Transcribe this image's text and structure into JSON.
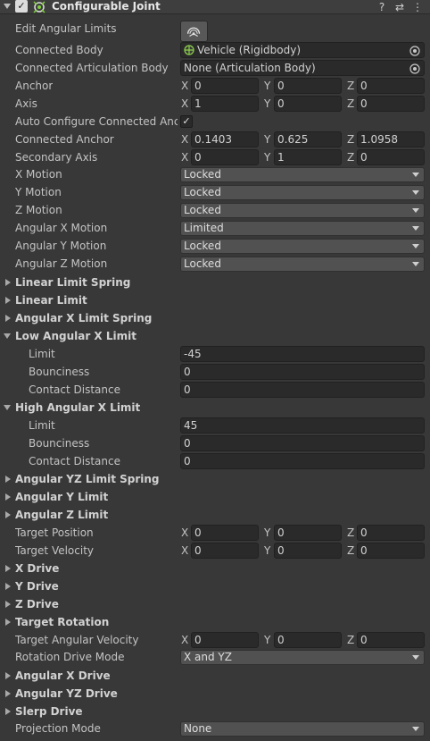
{
  "header": {
    "title": "Configurable Joint",
    "enabled_mark": "✓",
    "help_glyph": "?",
    "preset_glyph": "⇄",
    "menu_glyph": "⋮",
    "icon": "configurable-joint-icon"
  },
  "edit_angular_limits": {
    "label": "Edit Angular Limits",
    "icon": "angular-limits-icon"
  },
  "connected_body": {
    "label": "Connected Body",
    "value": "Vehicle (Rigidbody)"
  },
  "connected_articulation_body": {
    "label": "Connected Articulation Body",
    "value": "None (Articulation Body)"
  },
  "anchor": {
    "label": "Anchor",
    "x": "0",
    "y": "0",
    "z": "0"
  },
  "axis": {
    "label": "Axis",
    "x": "1",
    "y": "0",
    "z": "0"
  },
  "auto_configure": {
    "label": "Auto Configure Connected Anchor",
    "checked_mark": "✓"
  },
  "connected_anchor": {
    "label": "Connected Anchor",
    "x": "0.1403",
    "y": "0.625",
    "z": "1.0958"
  },
  "secondary_axis": {
    "label": "Secondary Axis",
    "x": "0",
    "y": "1",
    "z": "0"
  },
  "x_motion": {
    "label": "X Motion",
    "value": "Locked"
  },
  "y_motion": {
    "label": "Y Motion",
    "value": "Locked"
  },
  "z_motion": {
    "label": "Z Motion",
    "value": "Locked"
  },
  "angular_x_motion": {
    "label": "Angular X Motion",
    "value": "Limited"
  },
  "angular_y_motion": {
    "label": "Angular Y Motion",
    "value": "Locked"
  },
  "angular_z_motion": {
    "label": "Angular Z Motion",
    "value": "Locked"
  },
  "linear_limit_spring": {
    "label": "Linear Limit Spring"
  },
  "linear_limit": {
    "label": "Linear Limit"
  },
  "angular_x_limit_spring": {
    "label": "Angular X Limit Spring"
  },
  "low_angular_x_limit": {
    "label": "Low Angular X Limit",
    "limit_label": "Limit",
    "limit": "-45",
    "bounciness_label": "Bounciness",
    "bounciness": "0",
    "contact_distance_label": "Contact Distance",
    "contact_distance": "0"
  },
  "high_angular_x_limit": {
    "label": "High Angular X Limit",
    "limit_label": "Limit",
    "limit": "45",
    "bounciness_label": "Bounciness",
    "bounciness": "0",
    "contact_distance_label": "Contact Distance",
    "contact_distance": "0"
  },
  "angular_yz_limit_spring": {
    "label": "Angular YZ Limit Spring"
  },
  "angular_y_limit": {
    "label": "Angular Y Limit"
  },
  "angular_z_limit": {
    "label": "Angular Z Limit"
  },
  "target_position": {
    "label": "Target Position",
    "x": "0",
    "y": "0",
    "z": "0"
  },
  "target_velocity": {
    "label": "Target Velocity",
    "x": "0",
    "y": "0",
    "z": "0"
  },
  "x_drive": {
    "label": "X Drive"
  },
  "y_drive": {
    "label": "Y Drive"
  },
  "z_drive": {
    "label": "Z Drive"
  },
  "target_rotation": {
    "label": "Target Rotation"
  },
  "target_angular_velocity": {
    "label": "Target Angular Velocity",
    "x": "0",
    "y": "0",
    "z": "0"
  },
  "rotation_drive_mode": {
    "label": "Rotation Drive Mode",
    "value": "X and YZ"
  },
  "angular_x_drive": {
    "label": "Angular X Drive"
  },
  "angular_yz_drive": {
    "label": "Angular YZ Drive"
  },
  "slerp_drive": {
    "label": "Slerp Drive"
  },
  "projection_mode": {
    "label": "Projection Mode",
    "value": "None"
  },
  "axis_labels": {
    "x": "X",
    "y": "Y",
    "z": "Z"
  }
}
